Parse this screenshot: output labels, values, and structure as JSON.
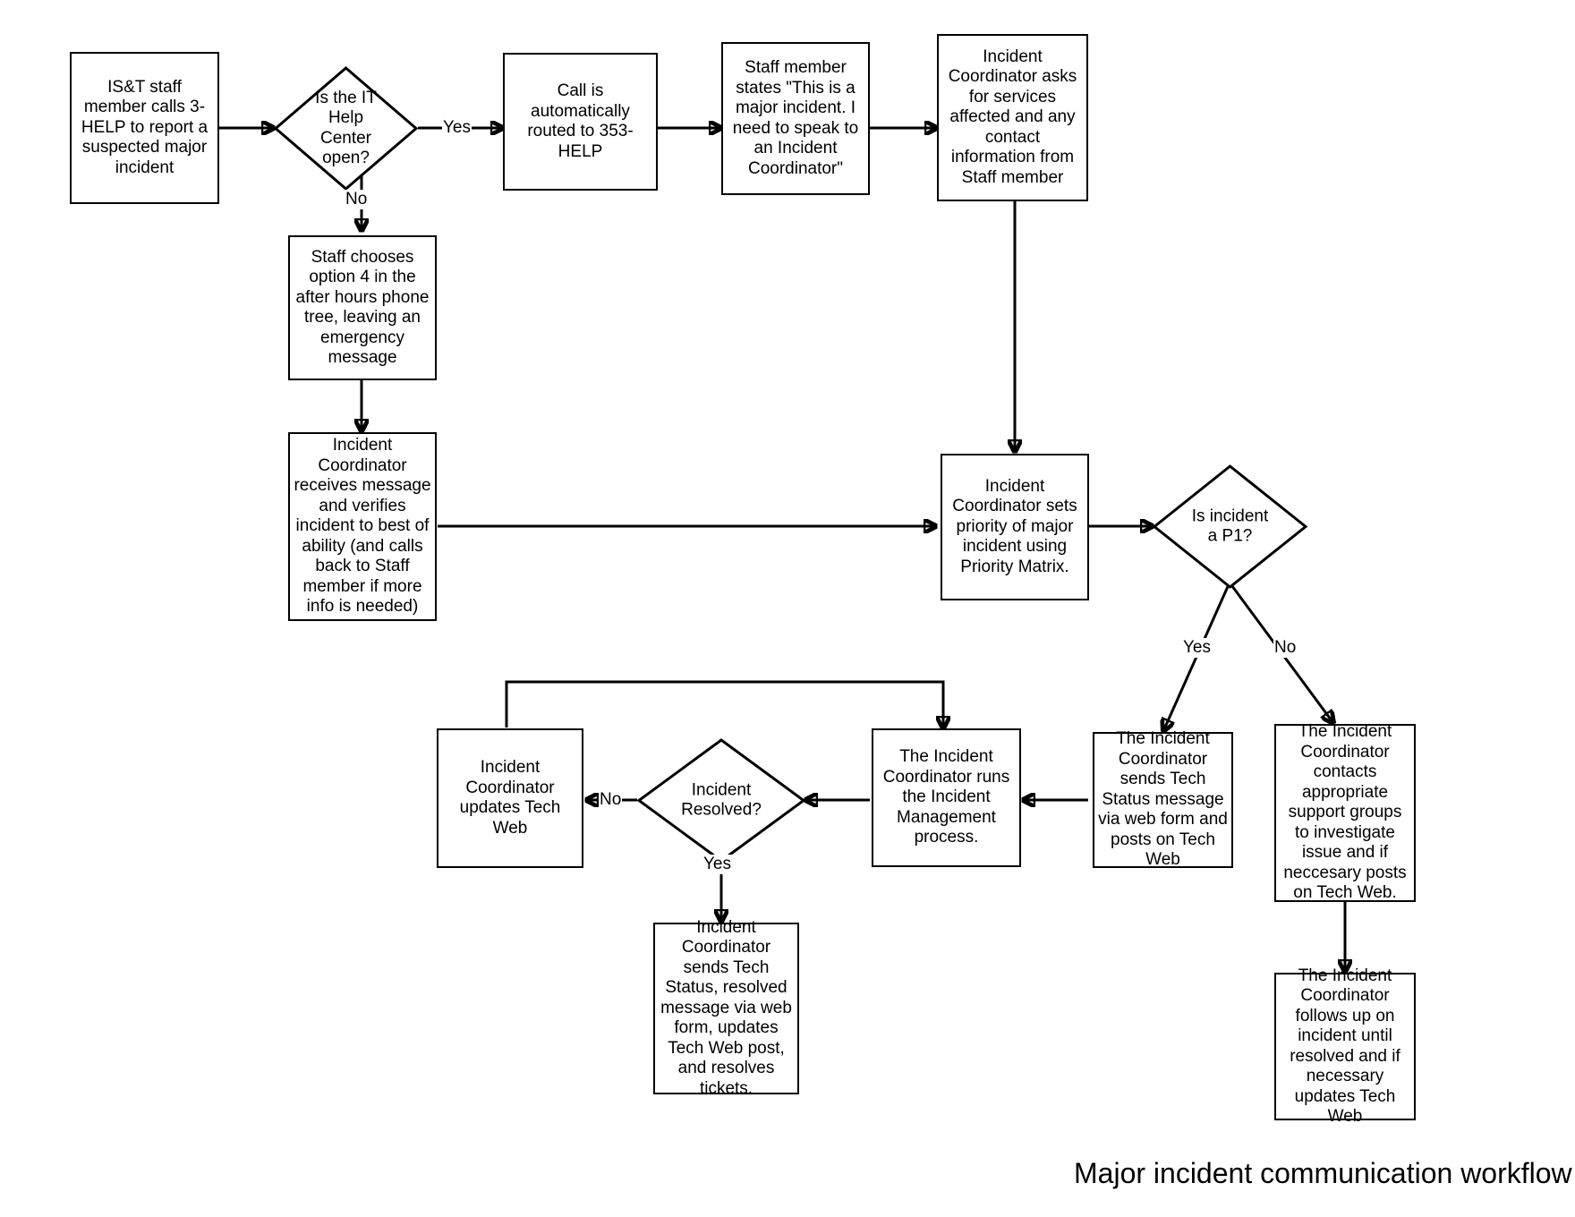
{
  "diagram": {
    "title": "Major incident communication workflow",
    "nodes": {
      "start_call": "IS&T staff member calls 3-HELP to report a suspected major incident",
      "help_center_open": "Is the IT Help Center open?",
      "routed_353": "Call is automatically routed to 353-HELP",
      "staff_states": "Staff member states \"This is a major incident. I need to speak to an Incident Coordinator\"",
      "coordinator_asks": "Incident Coordinator asks for services affected and any contact information from Staff member",
      "after_hours_option4": "Staff chooses option 4 in the after hours phone tree, leaving an emergency message",
      "coordinator_receives": "Incident Coordinator receives message and verifies incident to best of ability (and calls back to Staff member if more info is needed)",
      "sets_priority": "Incident Coordinator sets priority of major incident using Priority Matrix.",
      "is_p1": "Is incident a P1?",
      "sends_tech_status": "The Incident Coordinator sends Tech Status message via web form and posts on Tech Web",
      "contacts_support_groups": "The Incident Coordinator contacts appropriate support groups to investigate issue and if neccesary posts on Tech Web.",
      "follows_up": "The Incident Coordinator follows up on incident until resolved and if necessary updates Tech Web",
      "runs_im_process": "The Incident Coordinator runs the Incident Management process.",
      "incident_resolved": "Incident Resolved?",
      "updates_tech_web": "Incident Coordinator updates Tech Web",
      "sends_resolved": "Incident Coordinator sends Tech Status, resolved message via web form, updates Tech Web post, and resolves tickets."
    },
    "edge_labels": {
      "help_center_yes": "Yes",
      "help_center_no": "No",
      "p1_yes": "Yes",
      "p1_no": "No",
      "resolved_no": "No",
      "resolved_yes": "Yes"
    },
    "colors": {
      "stroke": "#000000",
      "fill": "#ffffff",
      "text": "#000000"
    }
  }
}
